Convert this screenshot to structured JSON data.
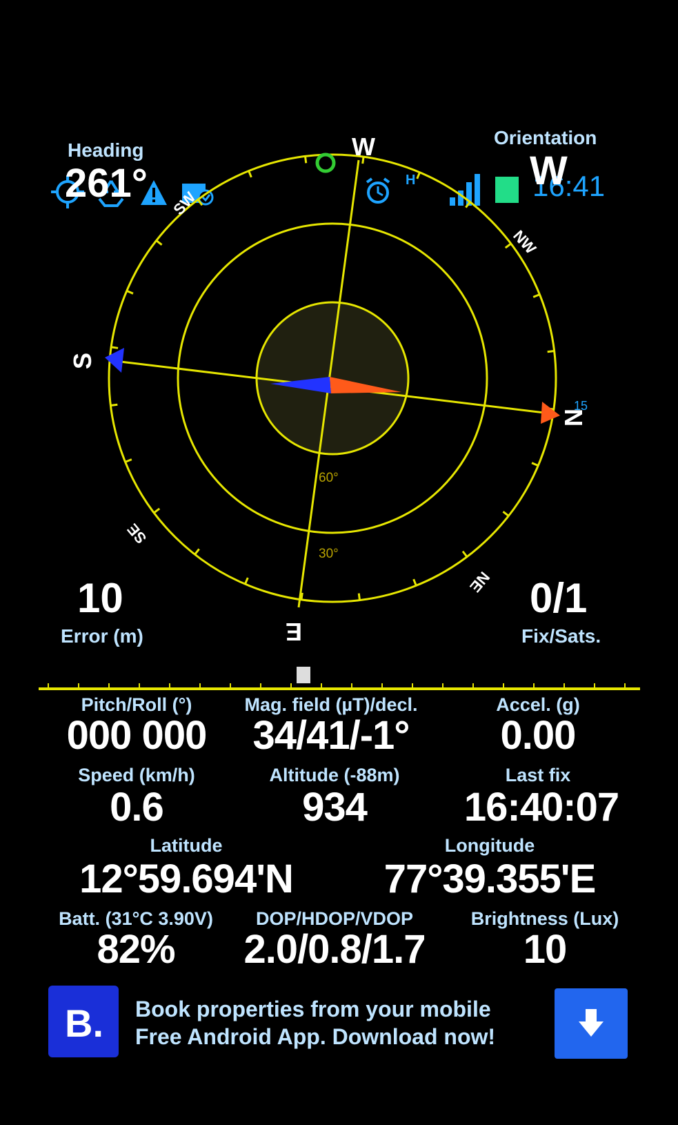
{
  "status_bar": {
    "icons_left": [
      "gps-target-icon",
      "recycle-icon",
      "warning-icon",
      "image-notification-icon"
    ],
    "icons_right": [
      "alarm-icon",
      "h-network-icon",
      "signal-bars-icon",
      "battery-icon"
    ],
    "time": "16:41",
    "network_type": "H"
  },
  "heading": {
    "label": "Heading",
    "value": "261°"
  },
  "orientation": {
    "label": "Orientation",
    "value": "W"
  },
  "compass": {
    "heading_degrees": 261,
    "cardinals": {
      "top": "W",
      "left": "S",
      "right": "N",
      "bottom": "E"
    },
    "intercardinals": {
      "upper_left": "SW",
      "upper_right": "NW",
      "lower_left": "SE",
      "lower_right": "NE"
    },
    "ring_labels": {
      "inner": "60°",
      "middle": "30°"
    },
    "satellite_label": "15",
    "colors": {
      "ring": "#e6e600",
      "north_arrow": "#ff5a1a",
      "south_arrow": "#2233ff",
      "satellite_marker": "#33cc33",
      "center_fill": "#202010"
    }
  },
  "error": {
    "value": "10",
    "label": "Error (m)"
  },
  "fix_sats": {
    "value": "0/1",
    "label": "Fix/Sats."
  },
  "level_indicator": {
    "position_fraction": 0.44
  },
  "stats": {
    "pitch_roll": {
      "label": "Pitch/Roll (°)",
      "value": "000 000"
    },
    "mag_field": {
      "label": "Mag. field (µT)/decl.",
      "value": "34/41/-1°"
    },
    "accel": {
      "label": "Accel. (g)",
      "value": "0.00"
    },
    "speed": {
      "label": "Speed (km/h)",
      "value": "0.6"
    },
    "altitude": {
      "label": "Altitude (-88m)",
      "value": "934"
    },
    "last_fix": {
      "label": "Last fix",
      "value": "16:40:07"
    },
    "latitude": {
      "label": "Latitude",
      "value": "12°59.694'N"
    },
    "longitude": {
      "label": "Longitude",
      "value": "77°39.355'E"
    },
    "battery": {
      "label": "Batt. (31°C 3.90V)",
      "value": "82%"
    },
    "dop": {
      "label": "DOP/HDOP/VDOP",
      "value": "2.0/0.8/1.7"
    },
    "brightness": {
      "label": "Brightness (Lux)",
      "value": "10"
    }
  },
  "ad": {
    "logo_text": "B.",
    "line1": "Book properties from your mobile",
    "line2": "Free Android App. Download now!",
    "colors": {
      "logo_bg": "#1a2fd8",
      "download_bg": "#2266ee"
    }
  }
}
